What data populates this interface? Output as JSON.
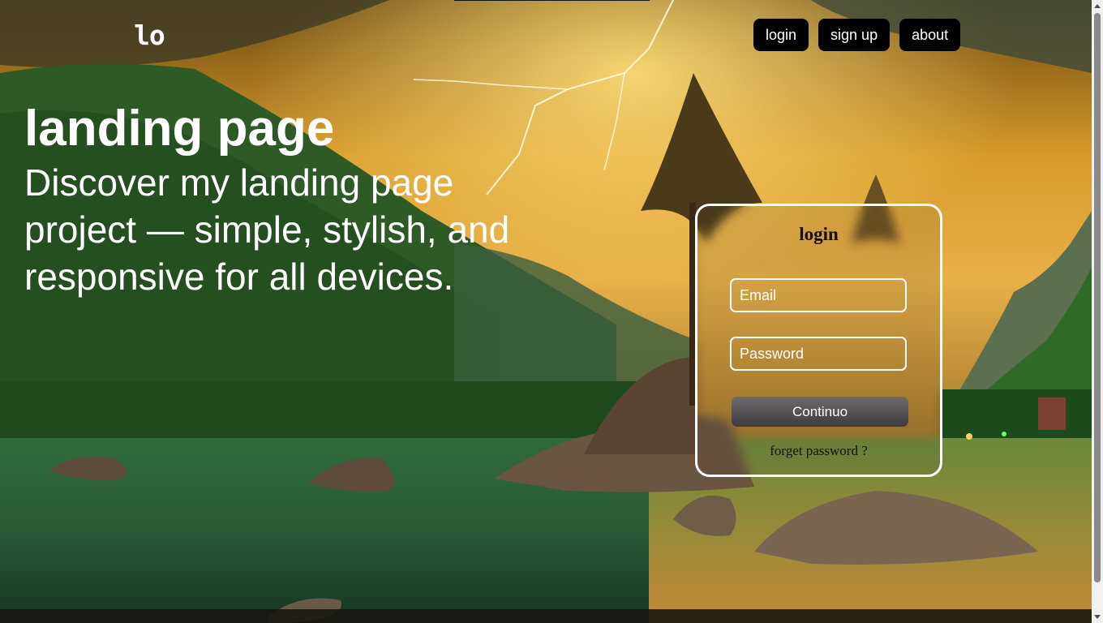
{
  "logo": {
    "text": "lo"
  },
  "nav": {
    "login_label": "login",
    "signup_label": "sign up",
    "about_label": "about"
  },
  "hero": {
    "title": "landing page",
    "subtitle": "Discover my landing page project — simple, stylish, and responsive for all devices."
  },
  "login_form": {
    "title": "login",
    "email_placeholder": "Email",
    "password_placeholder": "Password",
    "submit_label": "Continuo",
    "forgot_label": "forget password ?"
  },
  "colors": {
    "nav_button_bg": "#000000",
    "text_light": "#ffffff",
    "card_border": "#ffffff",
    "submit_bg": "#5a5558"
  }
}
